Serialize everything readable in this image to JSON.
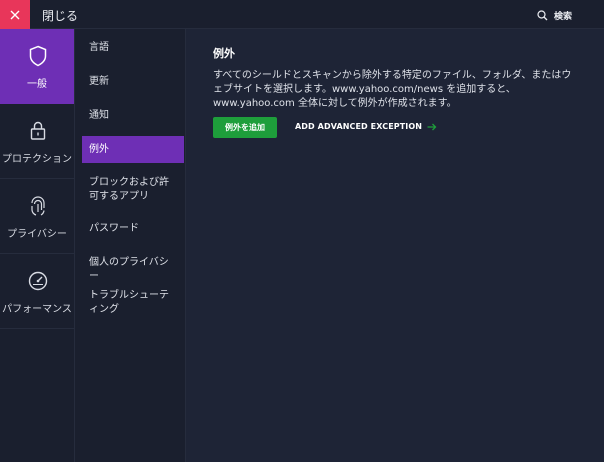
{
  "topbar": {
    "close_label": "閉じる",
    "search_label": "検索"
  },
  "categories": [
    {
      "label": "一般",
      "icon": "shield-icon",
      "active": true
    },
    {
      "label": "プロテクション",
      "icon": "lock-icon",
      "active": false
    },
    {
      "label": "プライバシー",
      "icon": "fingerprint-icon",
      "active": false
    },
    {
      "label": "パフォーマンス",
      "icon": "speedometer-icon",
      "active": false
    }
  ],
  "submenu": [
    {
      "label": "言語"
    },
    {
      "label": "更新"
    },
    {
      "label": "通知"
    },
    {
      "label": "例外",
      "active": true
    },
    {
      "label": "ブロックおよび許可するアプリ"
    },
    {
      "label": "パスワード"
    },
    {
      "label": "個人のプライバシー"
    },
    {
      "label": "トラブルシューティング"
    }
  ],
  "main": {
    "title": "例外",
    "description": "すべてのシールドとスキャンから除外する特定のファイル、フォルダ、またはウェブサイトを選択します。www.yahoo.com/news を追加すると、www.yahoo.com 全体に対して例外が作成されます。",
    "add_button_label": "例外を追加",
    "advanced_label": "ADD ADVANCED EXCEPTION"
  },
  "colors": {
    "accent": "#6e2fb5",
    "close": "#e8365a",
    "green": "#1e9e3b",
    "background": "#1e2436"
  }
}
